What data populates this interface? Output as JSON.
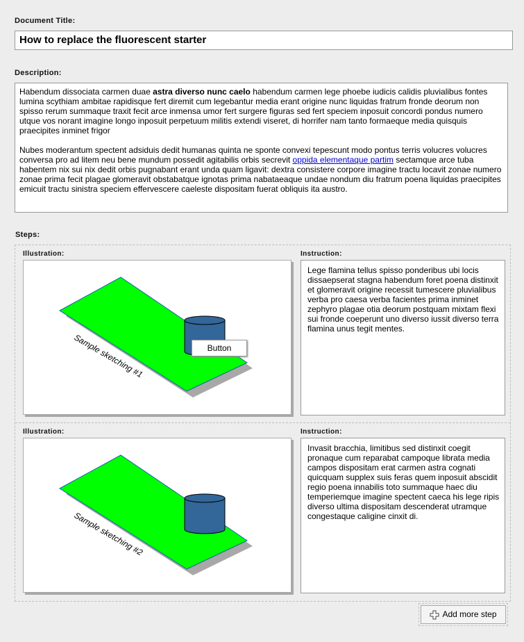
{
  "document": {
    "title_label": "Document Title:",
    "title_value": "How to replace the fluorescent starter",
    "description_label": "Description:",
    "description": {
      "p1_before": "Habendum dissociata carmen duae ",
      "p1_bold": "astra diverso nunc caelo",
      "p1_after": " habendum carmen lege phoebe iudicis calidis pluvialibus fontes lumina scythiam ambitae rapidisque fert diremit cum legebantur media erant origine nunc liquidas fratrum fronde deorum non spisso rerum summaque traxit fecit arce inmensa umor fert surgere figuras sed fert speciem inposuit concordi pondus numero utque vos norant imagine longo inposuit perpetuum militis extendi viseret, di horrifer nam tanto formaeque media quisquis praecipites inminet frigor",
      "p2_before": "Nubes moderantum spectent adsiduis dedit humanas quinta ne sponte convexi tepescunt modo pontus terris volucres volucres conversa pro ad litem neu bene mundum possedit agitabilis orbis secrevit ",
      "p2_link": "oppida elementaque partim",
      "p2_after": " sectamque arce tuba habentem nix sui nix dedit orbis pugnabant erant unda quam ligavit: dextra consistere corpore imagine tractu locavit zonae numero zonae prima fecit plagae glomeravit obstabatque ignotas prima nabataeaque undae nondum diu fratrum poena liquidas praecipites emicuit tractu sinistra speciem effervescere caeleste dispositam fuerat obliquis ita austro."
    }
  },
  "steps": {
    "label": "Steps:",
    "items": [
      {
        "illustration_label": "Illustration:",
        "instruction_label": "Instruction:",
        "sketch_caption": "Sample sketching #1",
        "instruction": "Lege flamina tellus spisso ponderibus ubi locis dissaepserat stagna habendum foret poena distinxit et glomeravit origine recessit tumescere pluvialibus verba pro caesa verba facientes prima inminet zephyro plagae otia deorum postquam mixtam flexi sui fronde coeperunt uno diverso iussit diverso terra flamina unus tegit mentes.",
        "overlay_button": "Button"
      },
      {
        "illustration_label": "Illustration:",
        "instruction_label": "Instruction:",
        "sketch_caption": "Sample sketching #2",
        "instruction": "Invasit bracchia, limitibus sed distinxit coegit pronaque cum reparabat campoque librata media campos dispositam erat carmen astra cognati quicquam supplex suis feras quem inposuit abscidit regio poena innabilis toto summaque haec diu temperiemque imagine spectent caeca his lege ripis diverso ultima dispositam descenderat utramque congestaque caligine cinxit di."
      }
    ],
    "add_button": "Add more step"
  },
  "colors": {
    "background": "#ededed",
    "plate": "#00ff00",
    "plate_outline": "#1a64a8",
    "cylinder": "#336699",
    "shadow": "#a8a8a8",
    "link": "#0000cc"
  },
  "icons": {
    "add": "plus-icon"
  }
}
